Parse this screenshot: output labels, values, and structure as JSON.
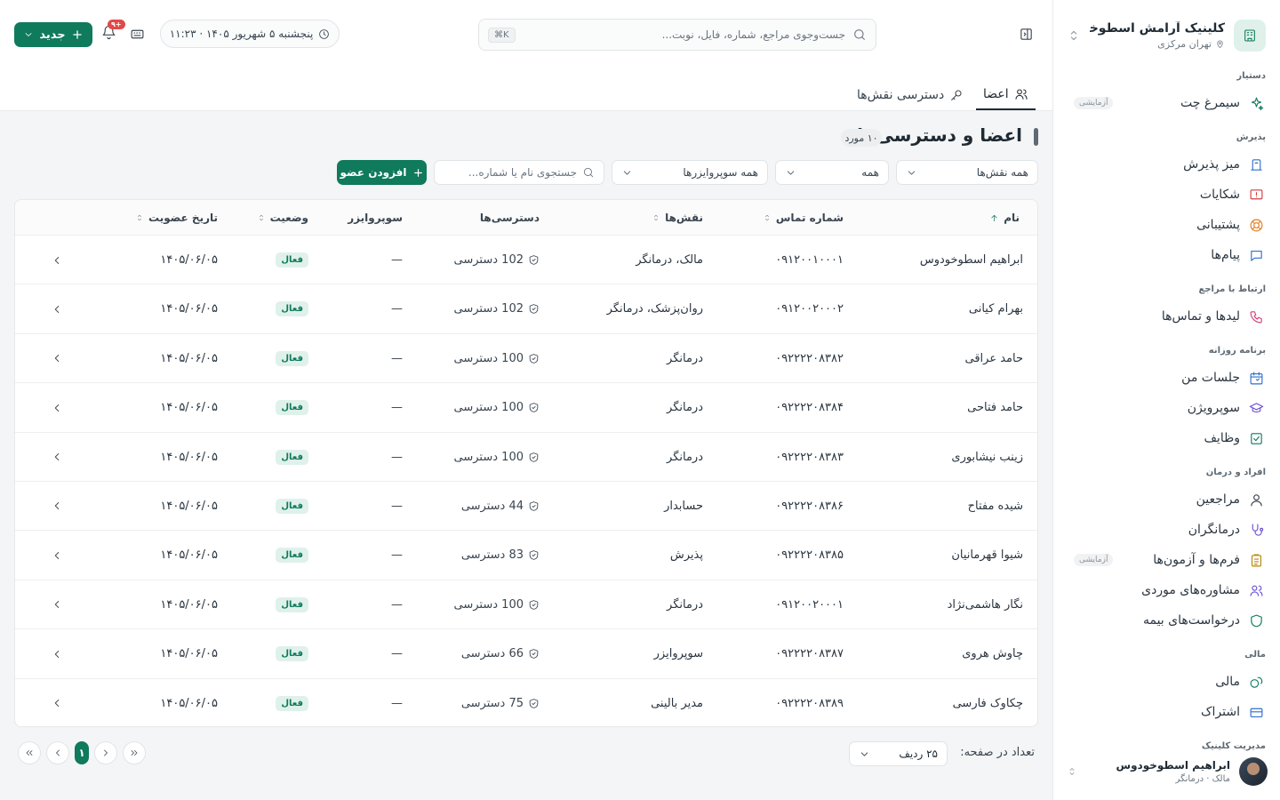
{
  "clinic": {
    "name": "کلینیک آرامش اسطوخو...",
    "location": "تهران مرکزی"
  },
  "sidebar": {
    "sections": [
      {
        "label": "دستیار",
        "items": [
          {
            "label": "سیمرغ چت",
            "icon": "sparkle-icon",
            "badge": "آزمایشی"
          }
        ]
      },
      {
        "label": "پذیرش",
        "items": [
          {
            "label": "میز پذیرش",
            "icon": "desk-bell-icon"
          },
          {
            "label": "شکایات",
            "icon": "alert-message-icon"
          },
          {
            "label": "پشتیبانی",
            "icon": "lifebuoy-icon"
          },
          {
            "label": "پیام‌ها",
            "icon": "message-icon"
          }
        ]
      },
      {
        "label": "ارتباط با مراجع",
        "items": [
          {
            "label": "لیدها و تماس‌ها",
            "icon": "phone-icon"
          }
        ]
      },
      {
        "label": "برنامه روزانه",
        "items": [
          {
            "label": "جلسات من",
            "icon": "calendar-icon"
          },
          {
            "label": "سوپرویژن",
            "icon": "graduation-cap-icon"
          },
          {
            "label": "وظایف",
            "icon": "checkbox-icon"
          }
        ]
      },
      {
        "label": "افراد و درمان",
        "items": [
          {
            "label": "مراجعین",
            "icon": "user-icon"
          },
          {
            "label": "درمانگران",
            "icon": "stethoscope-icon"
          },
          {
            "label": "فرم‌ها و آزمون‌ها",
            "icon": "clipboard-icon",
            "badge": "آزمایشی"
          },
          {
            "label": "مشاوره‌های موردی",
            "icon": "users-icon"
          },
          {
            "label": "درخواست‌های بیمه",
            "icon": "shield-icon"
          }
        ]
      },
      {
        "label": "مالی",
        "items": [
          {
            "label": "مالی",
            "icon": "coins-icon"
          },
          {
            "label": "اشتراک",
            "icon": "credit-card-icon"
          }
        ]
      },
      {
        "label": "مدیریت کلینیک",
        "items": []
      }
    ]
  },
  "user": {
    "name": "ابراهیم اسطوخودوس",
    "role": "مالک · درمانگر"
  },
  "topbar": {
    "new_button": "جدید",
    "notifications_badge": "۹+",
    "datetime": "پنجشنبه ۵ شهریور ۱۴۰۵ · ۱۱:۲۳",
    "search_placeholder": "جست‌وجوی مراجع، شماره، فایل، نوبت...",
    "search_shortcut": "⌘K"
  },
  "tabs": [
    {
      "label": "اعضا",
      "icon": "users-icon",
      "active": true
    },
    {
      "label": "دسترسی نقش‌ها",
      "icon": "key-icon",
      "active": false
    }
  ],
  "page": {
    "title": "اعضا و دسترسی‌ها",
    "count": "۱۰ مورد"
  },
  "filters": {
    "roles": "همه نقش‌ها",
    "status": "همه",
    "supervisors": "همه سوپروایزرها",
    "search_placeholder": "جستجوی نام یا شماره...",
    "add_button": "افزودن عضو"
  },
  "table": {
    "columns": {
      "name": "نام",
      "phone": "شماره تماس",
      "roles": "نقش‌ها",
      "access": "دسترسی‌ها",
      "supervisor": "سوپروایزر",
      "status": "وضعیت",
      "joined": "تاریخ عضویت"
    },
    "rows": [
      {
        "name": "ابراهیم اسطوخودوس",
        "phone": "۰۹۱۲۰۰۱۰۰۰۱",
        "roles": "مالک، درمانگر",
        "access": "102 دسترسی",
        "supervisor": "—",
        "status": "فعال",
        "joined": "۱۴۰۵/۰۶/۰۵"
      },
      {
        "name": "بهرام کیانی",
        "phone": "۰۹۱۲۰۰۲۰۰۰۲",
        "roles": "روان‌پزشک، درمانگر",
        "access": "102 دسترسی",
        "supervisor": "—",
        "status": "فعال",
        "joined": "۱۴۰۵/۰۶/۰۵"
      },
      {
        "name": "حامد عراقی",
        "phone": "۰۹۲۲۲۲۰۸۳۸۲",
        "roles": "درمانگر",
        "access": "100 دسترسی",
        "supervisor": "—",
        "status": "فعال",
        "joined": "۱۴۰۵/۰۶/۰۵"
      },
      {
        "name": "حامد فتاحی",
        "phone": "۰۹۲۲۲۲۰۸۳۸۴",
        "roles": "درمانگر",
        "access": "100 دسترسی",
        "supervisor": "—",
        "status": "فعال",
        "joined": "۱۴۰۵/۰۶/۰۵"
      },
      {
        "name": "زینب نیشابوری",
        "phone": "۰۹۲۲۲۲۰۸۳۸۳",
        "roles": "درمانگر",
        "access": "100 دسترسی",
        "supervisor": "—",
        "status": "فعال",
        "joined": "۱۴۰۵/۰۶/۰۵"
      },
      {
        "name": "شیده مفتاح",
        "phone": "۰۹۲۲۲۲۰۸۳۸۶",
        "roles": "حسابدار",
        "access": "44 دسترسی",
        "supervisor": "—",
        "status": "فعال",
        "joined": "۱۴۰۵/۰۶/۰۵"
      },
      {
        "name": "شیوا قهرمانیان",
        "phone": "۰۹۲۲۲۲۰۸۳۸۵",
        "roles": "پذیرش",
        "access": "83 دسترسی",
        "supervisor": "—",
        "status": "فعال",
        "joined": "۱۴۰۵/۰۶/۰۵"
      },
      {
        "name": "نگار هاشمی‌نژاد",
        "phone": "۰۹۱۲۰۰۲۰۰۰۱",
        "roles": "درمانگر",
        "access": "100 دسترسی",
        "supervisor": "—",
        "status": "فعال",
        "joined": "۱۴۰۵/۰۶/۰۵"
      },
      {
        "name": "چاوش هروی",
        "phone": "۰۹۲۲۲۲۰۸۳۸۷",
        "roles": "سوپروایزر",
        "access": "66 دسترسی",
        "supervisor": "—",
        "status": "فعال",
        "joined": "۱۴۰۵/۰۶/۰۵"
      },
      {
        "name": "چکاوک فارسی",
        "phone": "۰۹۲۲۲۲۰۸۳۸۹",
        "roles": "مدیر بالینی",
        "access": "75 دسترسی",
        "supervisor": "—",
        "status": "فعال",
        "joined": "۱۴۰۵/۰۶/۰۵"
      }
    ]
  },
  "pagination": {
    "current_page": "۱",
    "per_page_label": "تعداد در صفحه:",
    "per_page_value": "۲۵ ردیف"
  },
  "colors": {
    "primary": "#0f7a5c",
    "status_bg": "#dff1ea",
    "badge_red": "#e04a4a"
  }
}
